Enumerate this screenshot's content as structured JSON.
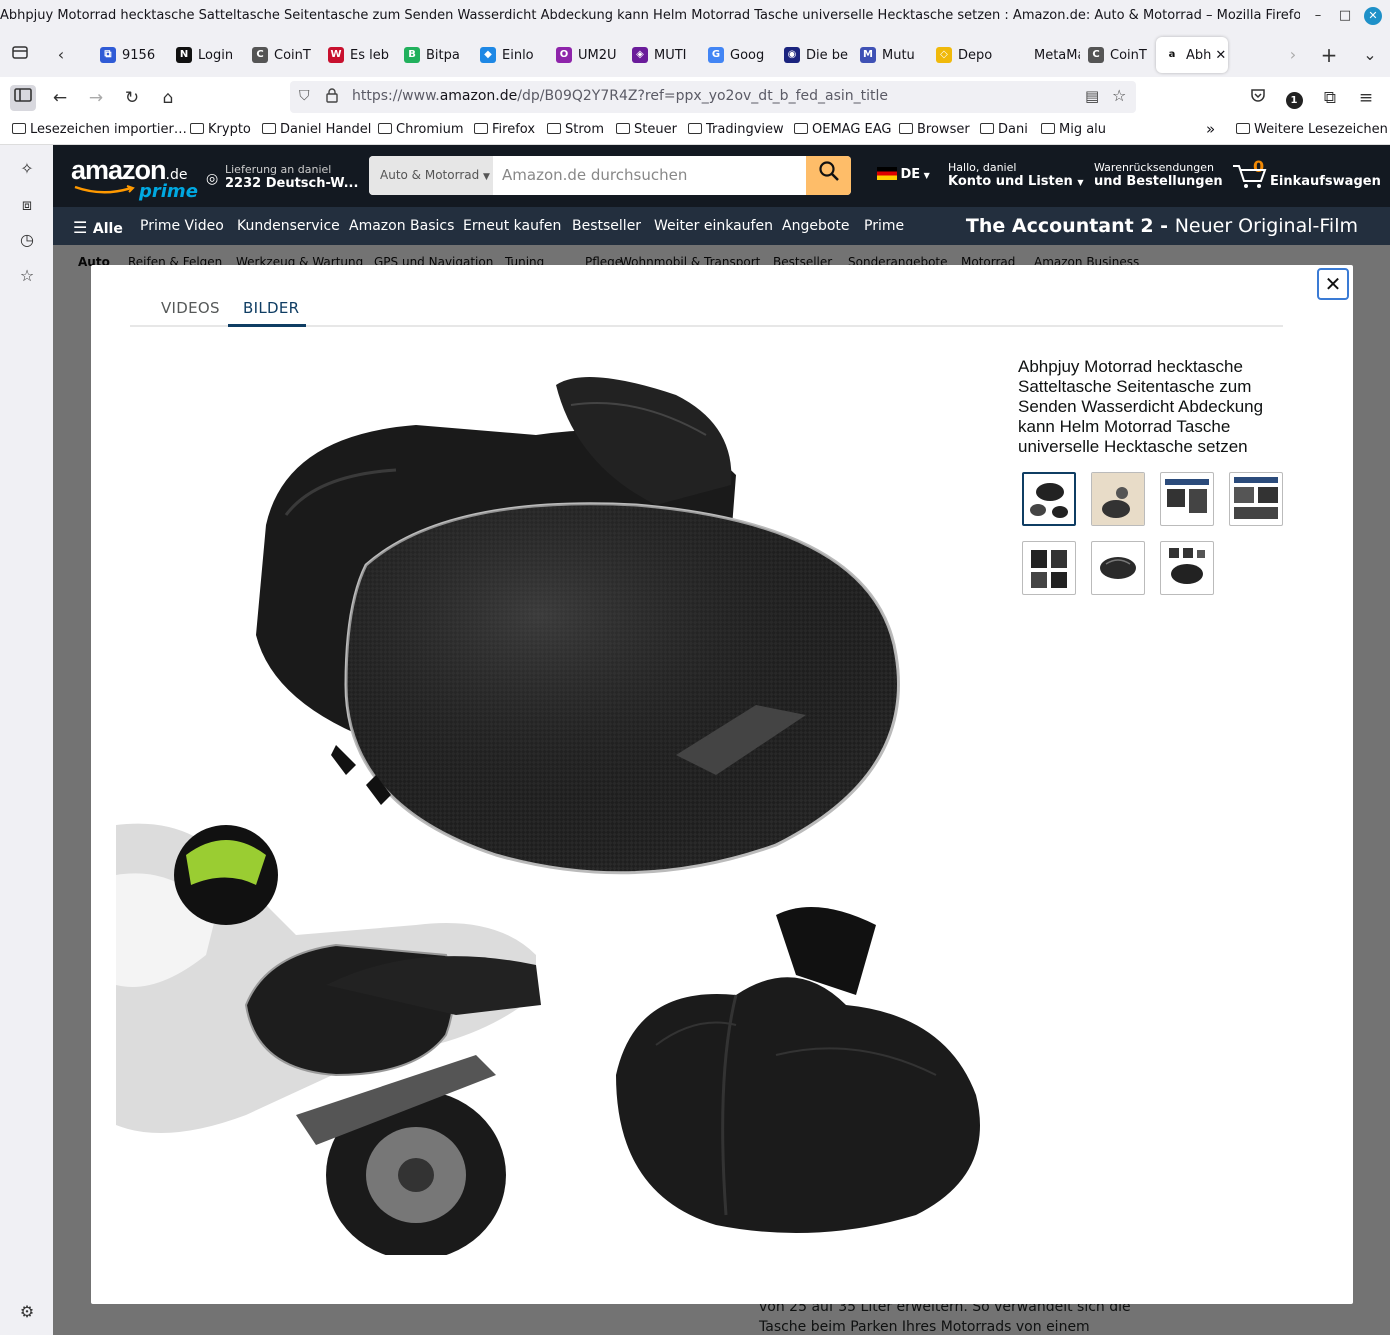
{
  "window": {
    "title": "Abhpjuy Motorrad hecktasche Satteltasche Seitentasche zum Senden Wasserdicht Abdeckung kann Helm Motorrad Tasche universelle Hecktasche setzen : Amazon.de: Auto & Motorrad – Mozilla Firefox",
    "minimize": "–",
    "maximize": "□",
    "close": "✕"
  },
  "tabs": [
    {
      "label": "9156",
      "fav": "⧉",
      "color": "#2f5bd6"
    },
    {
      "label": "Login",
      "fav": "N",
      "color": "#111111"
    },
    {
      "label": "CoinT",
      "fav": "C",
      "color": "#555555"
    },
    {
      "label": "Es leb",
      "fav": "W",
      "color": "#c8102e"
    },
    {
      "label": "Bitpa",
      "fav": "B",
      "color": "#21b05c"
    },
    {
      "label": "Einlo",
      "fav": "◆",
      "color": "#1e88e5"
    },
    {
      "label": "UM2U",
      "fav": "O",
      "color": "#8e24aa"
    },
    {
      "label": "MUTI",
      "fav": "◈",
      "color": "#6a1b9a"
    },
    {
      "label": "Goog",
      "fav": "G",
      "color": "#4285f4"
    },
    {
      "label": "Die be",
      "fav": "◉",
      "color": "#1a237e"
    },
    {
      "label": "Mutu",
      "fav": "M",
      "color": "#3f51b5"
    },
    {
      "label": "Depo",
      "fav": "◇",
      "color": "#f0b90b"
    },
    {
      "label": "MetaMas",
      "fav": "",
      "color": "#f0f0f4"
    },
    {
      "label": "CoinT",
      "fav": "C",
      "color": "#555555"
    },
    {
      "label": "Abh",
      "fav": "a",
      "color": "#ffffff",
      "active": true,
      "close": "✕"
    }
  ],
  "nav": {
    "url_prefix": "https://www.",
    "url_domain": "amazon.de",
    "url_path": "/dp/B09Q2Y7R4Z?ref=ppx_yo2ov_dt_b_fed_asin_title",
    "notification_count": "1"
  },
  "bookmarks": [
    "Lesezeichen importier…",
    "Krypto",
    "Daniel Handel",
    "Chromium",
    "Firefox",
    "Strom",
    "Steuer",
    "Tradingview",
    "OEMAG EAG",
    "Browser",
    "Dani",
    "Mig alu",
    "Weitere Lesezeichen"
  ],
  "amazon": {
    "logo": "amazon",
    "logo_tld": ".de",
    "logo_prime": "prime",
    "delivery_line1": "Lieferung an daniel",
    "delivery_line2": "2232 Deutsch-W...",
    "search_category": "Auto & Motorrad",
    "search_placeholder": "Amazon.de durchsuchen",
    "lang": "DE",
    "account_line1": "Hallo, daniel",
    "account_line2": "Konto und Listen",
    "returns_line1": "Warenrücksendungen",
    "returns_line2": "und Bestellungen",
    "cart_count": "0",
    "cart_label": "Einkaufswagen",
    "nav_items": [
      "Alle",
      "Prime Video",
      "Kundenservice",
      "Amazon Basics",
      "Erneut kaufen",
      "Bestseller",
      "Weiter einkaufen",
      "Angebote",
      "Prime"
    ],
    "promo_bold": "The Accountant 2 -",
    "promo_rest": "Neuer Original-Film",
    "sub_nav": [
      "Auto",
      "Reifen & Felgen",
      "Werkzeug & Wartung",
      "GPS und Navigation",
      "Tuning",
      "Pflege",
      "Wohnmobil & Transport",
      "Bestseller",
      "Sonderangebote",
      "Motorrad",
      "Amazon Business"
    ],
    "below_text_1": "von 25 auf 35 Liter erweitern. So verwandelt sich die",
    "below_text_2": "Tasche beim Parken Ihres Motorrads von einem"
  },
  "modal": {
    "tabs": [
      "VIDEOS",
      "BILDER"
    ],
    "active_tab": "BILDER",
    "close_label": "✕",
    "product_title": "Abhpjuy Motorrad hecktasche Satteltasche Seitentasche zum Senden Wasserdicht Abdeckung kann Helm Motorrad Tasche universelle Hecktasche setzen",
    "thumbnail_count": 7,
    "selected_thumbnail": 1
  },
  "colors": {
    "amazon_dark": "#131921",
    "amazon_nav": "#232f3e",
    "search_button": "#febd69",
    "prime_blue": "#00a8e1",
    "modal_accent": "#0f3d63"
  }
}
